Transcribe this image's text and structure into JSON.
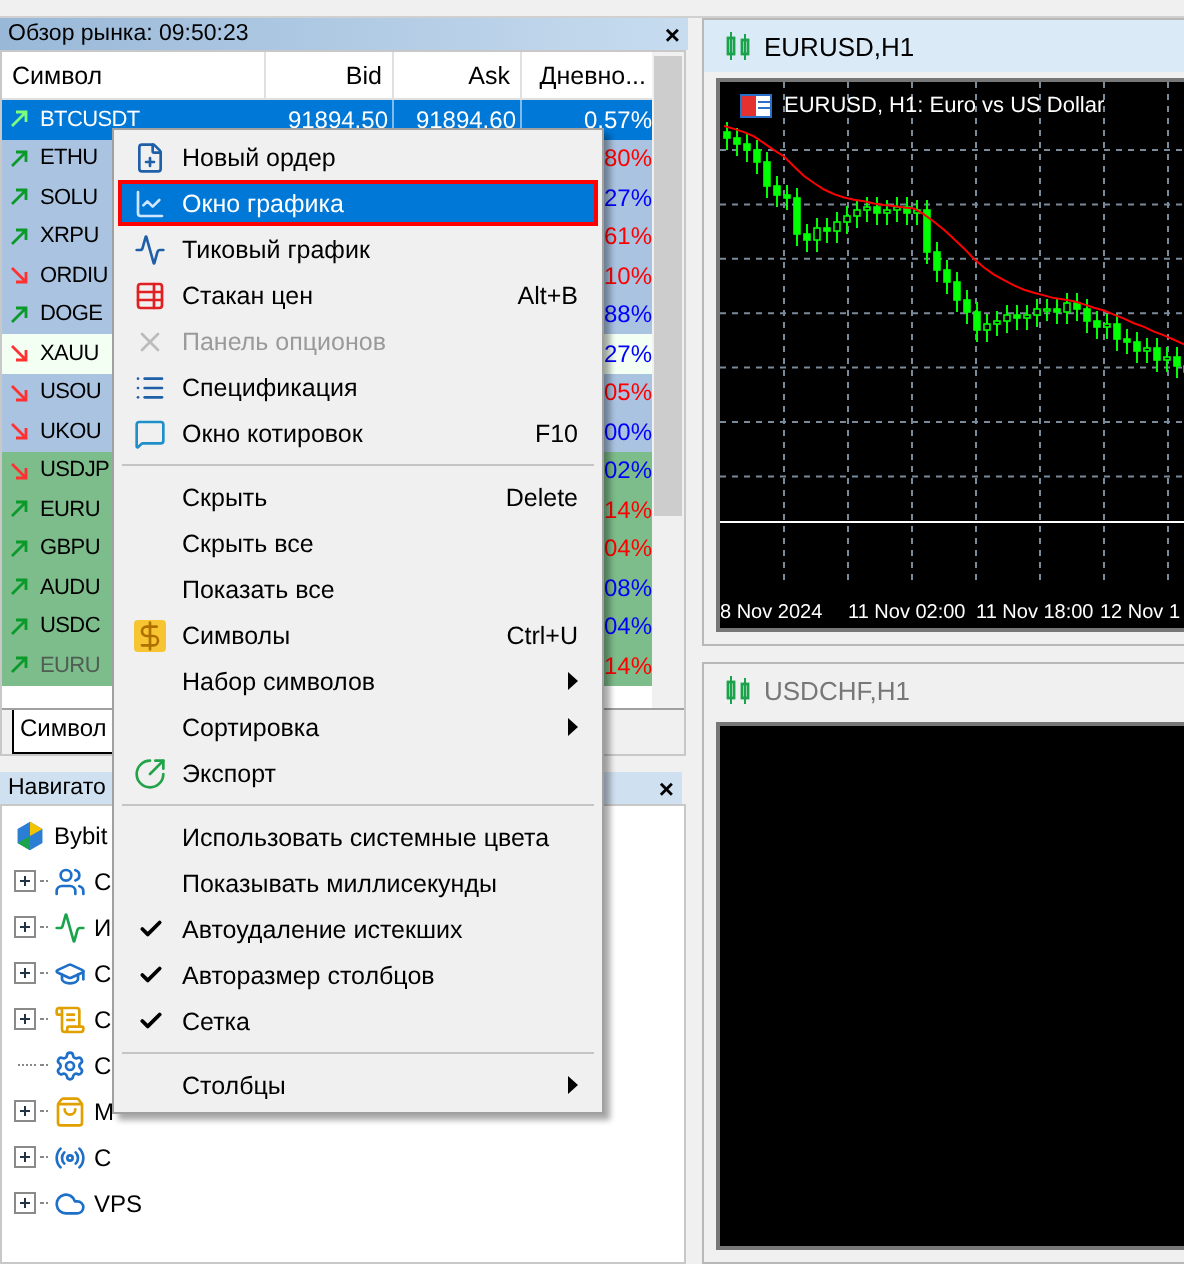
{
  "market_watch": {
    "title": "Обзор рынка: 09:50:23",
    "close": "×",
    "columns": [
      "Символ",
      "Bid",
      "Ask",
      "Дневно..."
    ],
    "rows": [
      {
        "symbol": "BTCUSDT",
        "bid": "91894.50",
        "ask": "91894.60",
        "change": "0.57%",
        "rising": true,
        "selected": true,
        "color": "#0078d7"
      },
      {
        "symbol": "ETHU",
        "change": "80%",
        "rising": true,
        "falling": true,
        "selected": false,
        "dimmed": false,
        "color": "#a9c3e1"
      },
      {
        "symbol": "SOLU",
        "change": "27%",
        "rising": true,
        "falling": false,
        "selected": false,
        "dimmed": false,
        "color": "#a9c3e1"
      },
      {
        "symbol": "XRPU",
        "change": "61%",
        "rising": true,
        "falling": true,
        "selected": false,
        "dimmed": false,
        "color": "#a9c3e1"
      },
      {
        "symbol": "ORDIU",
        "change": "10%",
        "rising": false,
        "falling": true,
        "selected": false,
        "dimmed": false,
        "color": "#a9c3e1"
      },
      {
        "symbol": "DOGE",
        "change": "88%",
        "rising": true,
        "falling": false,
        "selected": false,
        "dimmed": false,
        "color": "#a9c3e1"
      },
      {
        "symbol": "XAUU",
        "change": "27%",
        "rising": false,
        "falling": false,
        "selected": false,
        "dimmed": false,
        "color": "#f2fff2"
      },
      {
        "symbol": "USOU",
        "change": "05%",
        "rising": false,
        "falling": true,
        "selected": false,
        "dimmed": false,
        "color": "#a9c3e1"
      },
      {
        "symbol": "UKOU",
        "change": "00%",
        "rising": false,
        "falling": false,
        "selected": false,
        "dimmed": false,
        "color": "#a9c3e1"
      },
      {
        "symbol": "USDJP",
        "change": "02%",
        "rising": false,
        "falling": false,
        "selected": false,
        "dimmed": false,
        "color": "#7dbd8c"
      },
      {
        "symbol": "EURU",
        "change": "14%",
        "rising": true,
        "falling": true,
        "selected": false,
        "dimmed": false,
        "color": "#7dbd8c"
      },
      {
        "symbol": "GBPU",
        "change": "04%",
        "rising": true,
        "falling": true,
        "selected": false,
        "dimmed": false,
        "color": "#7dbd8c"
      },
      {
        "symbol": "AUDU",
        "change": "08%",
        "rising": true,
        "falling": false,
        "selected": false,
        "dimmed": false,
        "color": "#7dbd8c"
      },
      {
        "symbol": "USDC",
        "change": "04%",
        "rising": true,
        "falling": false,
        "selected": false,
        "dimmed": false,
        "color": "#7dbd8c"
      },
      {
        "symbol": "EURU",
        "change": "14%",
        "rising": true,
        "falling": true,
        "selected": false,
        "dimmed": true,
        "color": "#7dbd8c"
      }
    ],
    "tabs": [
      {
        "label": "Символ",
        "selected": true
      }
    ]
  },
  "navigator": {
    "title": "Навигато",
    "close": "×",
    "root": {
      "label": "Bybit",
      "children": [
        {
          "label": "С",
          "expandable": true
        },
        {
          "label": "И",
          "expandable": true
        },
        {
          "label": "С",
          "expandable": true
        },
        {
          "label": "С",
          "expandable": true
        },
        {
          "label": "С",
          "expandable": false
        },
        {
          "label": "М",
          "expandable": true
        },
        {
          "label": "С",
          "expandable": true
        },
        {
          "label": "VPS",
          "expandable": true
        }
      ]
    }
  },
  "context_menu": [
    {
      "kind": "item",
      "label": "Новый ордер",
      "selected": false,
      "disabled": false
    },
    {
      "kind": "item",
      "label": "Окно графика",
      "selected": true,
      "disabled": false
    },
    {
      "kind": "item",
      "label": "Тиковый график",
      "selected": false,
      "disabled": false
    },
    {
      "kind": "item",
      "label": "Стакан цен",
      "shortcut": "Alt+B",
      "selected": false,
      "disabled": false
    },
    {
      "kind": "item",
      "label": "Панель опционов",
      "selected": false,
      "disabled": true
    },
    {
      "kind": "item",
      "label": "Спецификация",
      "selected": false,
      "disabled": false
    },
    {
      "kind": "item",
      "label": "Окно котировок",
      "shortcut": "F10",
      "selected": false,
      "disabled": false
    },
    {
      "kind": "separator"
    },
    {
      "kind": "item",
      "label": "Скрыть",
      "shortcut": "Delete",
      "selected": false,
      "disabled": false
    },
    {
      "kind": "item",
      "label": "Скрыть все",
      "selected": false,
      "disabled": false
    },
    {
      "kind": "item",
      "label": "Показать все",
      "selected": false,
      "disabled": false
    },
    {
      "kind": "item",
      "label": "Символы",
      "shortcut": "Ctrl+U",
      "selected": false,
      "disabled": false
    },
    {
      "kind": "submenu",
      "label": "Набор символов",
      "selected": false,
      "disabled": false
    },
    {
      "kind": "submenu",
      "label": "Сортировка",
      "selected": false,
      "disabled": false
    },
    {
      "kind": "item",
      "label": "Экспорт",
      "selected": false,
      "disabled": false
    },
    {
      "kind": "separator"
    },
    {
      "kind": "check",
      "label": "Использовать системные цвета",
      "checked": false,
      "selected": false,
      "disabled": false
    },
    {
      "kind": "check",
      "label": "Показывать миллисекунды",
      "checked": false,
      "selected": false,
      "disabled": false
    },
    {
      "kind": "check",
      "label": "Автоудаление истекших",
      "checked": true,
      "selected": false,
      "disabled": false
    },
    {
      "kind": "check",
      "label": "Авторазмер столбцов",
      "checked": true,
      "selected": false,
      "disabled": false
    },
    {
      "kind": "check",
      "label": "Сетка",
      "checked": true,
      "selected": false,
      "disabled": false
    },
    {
      "kind": "separator"
    },
    {
      "kind": "submenu",
      "label": "Столбцы",
      "selected": false,
      "disabled": false
    }
  ],
  "charts": [
    {
      "title": "EURUSD,H1",
      "active": true,
      "label": "EURUSD, H1:  Euro vs US Dollar",
      "time_labels": [
        "8 Nov 2024",
        "11 Nov 02:00",
        "11 Nov 18:00",
        "12 Nov 1"
      ]
    },
    {
      "title": "USDCHF,H1",
      "active": false
    }
  ]
}
